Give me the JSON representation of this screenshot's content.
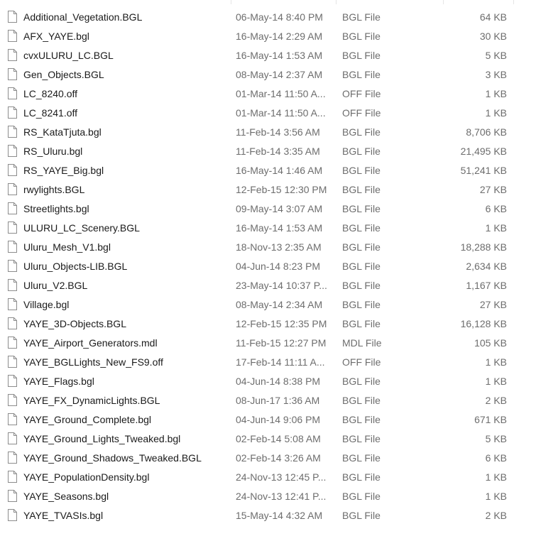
{
  "file_icon": "document-icon",
  "files": [
    {
      "name": "Additional_Vegetation.BGL",
      "date": "06-May-14 8:40 PM",
      "type": "BGL File",
      "size": "64 KB"
    },
    {
      "name": "AFX_YAYE.bgl",
      "date": "16-May-14 2:29 AM",
      "type": "BGL File",
      "size": "30 KB"
    },
    {
      "name": "cvxULURU_LC.BGL",
      "date": "16-May-14 1:53 AM",
      "type": "BGL File",
      "size": "5 KB"
    },
    {
      "name": "Gen_Objects.BGL",
      "date": "08-May-14 2:37 AM",
      "type": "BGL File",
      "size": "3 KB"
    },
    {
      "name": "LC_8240.off",
      "date": "01-Mar-14 11:50 A...",
      "type": "OFF File",
      "size": "1 KB"
    },
    {
      "name": "LC_8241.off",
      "date": "01-Mar-14 11:50 A...",
      "type": "OFF File",
      "size": "1 KB"
    },
    {
      "name": "RS_KataTjuta.bgl",
      "date": "11-Feb-14 3:56 AM",
      "type": "BGL File",
      "size": "8,706 KB"
    },
    {
      "name": "RS_Uluru.bgl",
      "date": "11-Feb-14 3:35 AM",
      "type": "BGL File",
      "size": "21,495 KB"
    },
    {
      "name": "RS_YAYE_Big.bgl",
      "date": "16-May-14 1:46 AM",
      "type": "BGL File",
      "size": "51,241 KB"
    },
    {
      "name": "rwylights.BGL",
      "date": "12-Feb-15 12:30 PM",
      "type": "BGL File",
      "size": "27 KB"
    },
    {
      "name": "Streetlights.bgl",
      "date": "09-May-14 3:07 AM",
      "type": "BGL File",
      "size": "6 KB"
    },
    {
      "name": "ULURU_LC_Scenery.BGL",
      "date": "16-May-14 1:53 AM",
      "type": "BGL File",
      "size": "1 KB"
    },
    {
      "name": "Uluru_Mesh_V1.bgl",
      "date": "18-Nov-13 2:35 AM",
      "type": "BGL File",
      "size": "18,288 KB"
    },
    {
      "name": "Uluru_Objects-LIB.BGL",
      "date": "04-Jun-14 8:23 PM",
      "type": "BGL File",
      "size": "2,634 KB"
    },
    {
      "name": "Uluru_V2.BGL",
      "date": "23-May-14 10:37 P...",
      "type": "BGL File",
      "size": "1,167 KB"
    },
    {
      "name": "Village.bgl",
      "date": "08-May-14 2:34 AM",
      "type": "BGL File",
      "size": "27 KB"
    },
    {
      "name": "YAYE_3D-Objects.BGL",
      "date": "12-Feb-15 12:35 PM",
      "type": "BGL File",
      "size": "16,128 KB"
    },
    {
      "name": "YAYE_Airport_Generators.mdl",
      "date": "11-Feb-15 12:27 PM",
      "type": "MDL File",
      "size": "105 KB"
    },
    {
      "name": "YAYE_BGLLights_New_FS9.off",
      "date": "17-Feb-14 11:11 A...",
      "type": "OFF File",
      "size": "1 KB"
    },
    {
      "name": "YAYE_Flags.bgl",
      "date": "04-Jun-14 8:38 PM",
      "type": "BGL File",
      "size": "1 KB"
    },
    {
      "name": "YAYE_FX_DynamicLights.BGL",
      "date": "08-Jun-17 1:36 AM",
      "type": "BGL File",
      "size": "2 KB"
    },
    {
      "name": "YAYE_Ground_Complete.bgl",
      "date": "04-Jun-14 9:06 PM",
      "type": "BGL File",
      "size": "671 KB"
    },
    {
      "name": "YAYE_Ground_Lights_Tweaked.bgl",
      "date": "02-Feb-14 5:08 AM",
      "type": "BGL File",
      "size": "5 KB"
    },
    {
      "name": "YAYE_Ground_Shadows_Tweaked.BGL",
      "date": "02-Feb-14 3:26 AM",
      "type": "BGL File",
      "size": "6 KB"
    },
    {
      "name": "YAYE_PopulationDensity.bgl",
      "date": "24-Nov-13 12:45 P...",
      "type": "BGL File",
      "size": "1 KB"
    },
    {
      "name": "YAYE_Seasons.bgl",
      "date": "24-Nov-13 12:41 P...",
      "type": "BGL File",
      "size": "1 KB"
    },
    {
      "name": "YAYE_TVASIs.bgl",
      "date": "15-May-14 4:32 AM",
      "type": "BGL File",
      "size": "2 KB"
    }
  ]
}
